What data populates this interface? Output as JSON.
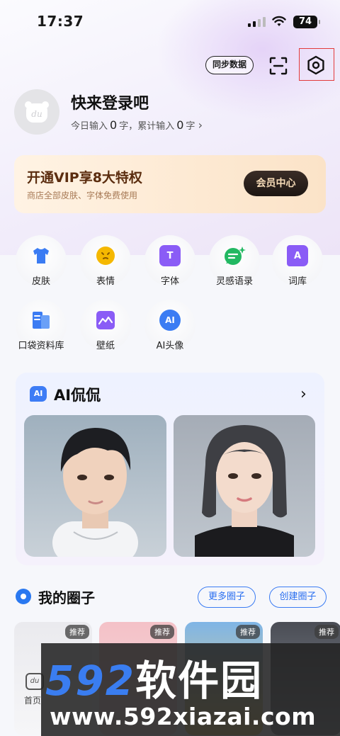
{
  "status_bar": {
    "time": "17:37",
    "battery": "74"
  },
  "header": {
    "sync_label": "同步数据"
  },
  "profile": {
    "name": "快来登录吧",
    "today_prefix": "今日输入",
    "today_count": "0",
    "today_unit": "字，",
    "total_prefix": "累计输入",
    "total_count": "0",
    "total_unit": "字",
    "chevron": "›",
    "avatar_text": "du"
  },
  "vip": {
    "title": "开通VIP享8大特权",
    "subtitle": "商店全部皮肤、字体免费使用",
    "button": "会员中心"
  },
  "grid": [
    {
      "label": "皮肤",
      "icon": "tshirt-icon",
      "color": "#3b7cf3",
      "glyph": ""
    },
    {
      "label": "表情",
      "icon": "emoji-icon",
      "color": "#f5b800",
      "glyph": ""
    },
    {
      "label": "字体",
      "icon": "font-icon",
      "color": "#8a5cf6",
      "glyph": "T"
    },
    {
      "label": "灵感语录",
      "icon": "quote-icon",
      "color": "#22b862",
      "glyph": ""
    },
    {
      "label": "词库",
      "icon": "dictionary-icon",
      "color": "#8a5cf6",
      "glyph": "A"
    },
    {
      "label": "口袋资料库",
      "icon": "pocket-library-icon",
      "color": "#3b7cf3",
      "glyph": ""
    },
    {
      "label": "壁纸",
      "icon": "wallpaper-icon",
      "color": "#8a5cf6",
      "glyph": ""
    },
    {
      "label": "AI头像",
      "icon": "ai-avatar-icon",
      "color": "#3b7cf3",
      "glyph": "AI"
    }
  ],
  "ai": {
    "badge": "AI",
    "title": "AI侃侃",
    "arrow": "›"
  },
  "circles": {
    "title": "我的圈子",
    "more": "更多圈子",
    "create": "创建圈子",
    "tag": "推荐",
    "first_caption": "首页",
    "logo_text": "du"
  },
  "watermark": {
    "brand_num": "592",
    "brand_text": "软件园",
    "url": "www.592xiazai.com"
  },
  "colors": {
    "accent": "#3b7cf3",
    "vip_text": "#5b2d0f",
    "highlight_box": "#e23b3b"
  }
}
